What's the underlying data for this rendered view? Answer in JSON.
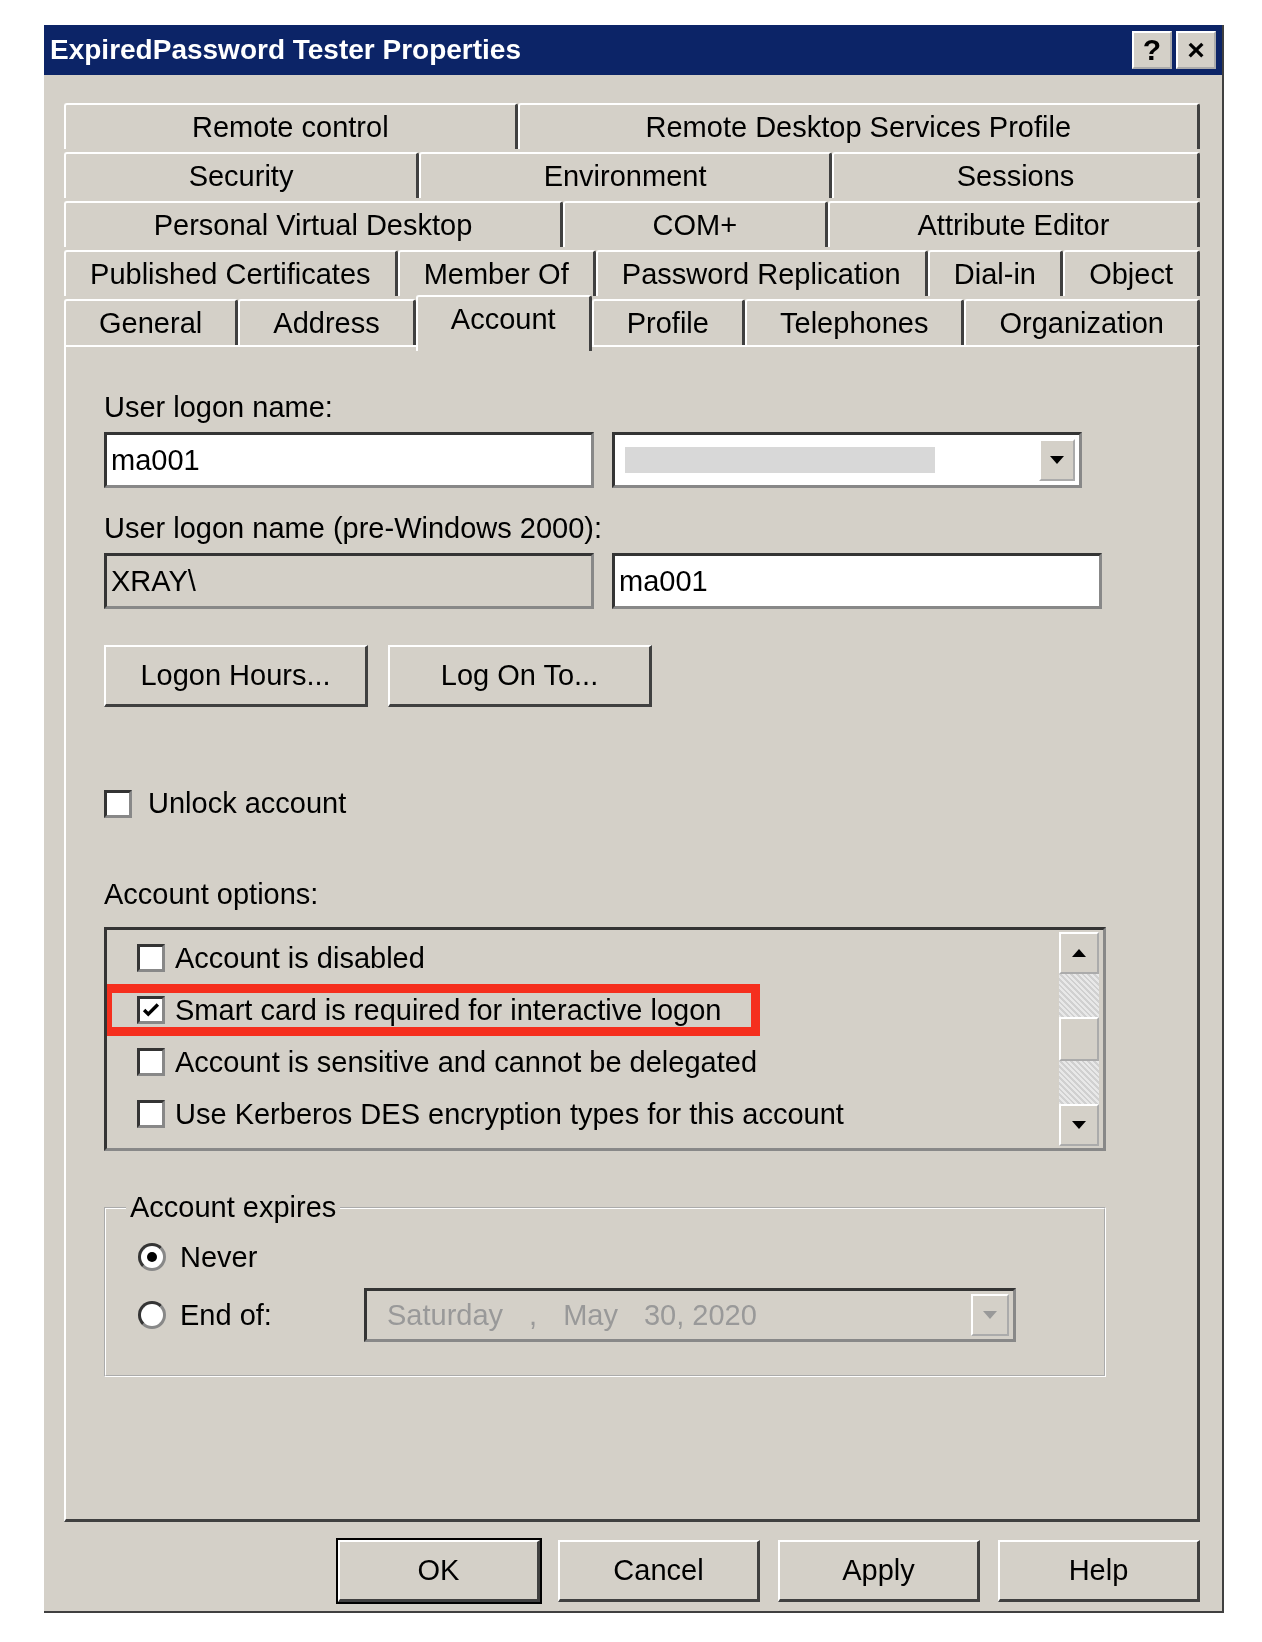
{
  "window": {
    "title": "ExpiredPassword Tester Properties",
    "buttons": [
      "?",
      "×"
    ]
  },
  "tab_rows": [
    [
      {
        "label": "Remote control",
        "selected": false
      },
      {
        "label": "Remote Desktop Services Profile",
        "selected": false
      }
    ],
    [
      {
        "label": "Security",
        "selected": false
      },
      {
        "label": "Environment",
        "selected": false
      },
      {
        "label": "Sessions",
        "selected": false
      }
    ],
    [
      {
        "label": "Personal Virtual Desktop",
        "selected": false
      },
      {
        "label": "COM+",
        "selected": false
      },
      {
        "label": "Attribute Editor",
        "selected": false
      }
    ],
    [
      {
        "label": "Published Certificates",
        "selected": false
      },
      {
        "label": "Member Of",
        "selected": false
      },
      {
        "label": "Password Replication",
        "selected": false
      },
      {
        "label": "Dial-in",
        "selected": false
      },
      {
        "label": "Object",
        "selected": false
      }
    ],
    [
      {
        "label": "General",
        "selected": false
      },
      {
        "label": "Address",
        "selected": false
      },
      {
        "label": "Account",
        "selected": true
      },
      {
        "label": "Profile",
        "selected": false
      },
      {
        "label": "Telephones",
        "selected": false
      },
      {
        "label": "Organization",
        "selected": false
      }
    ]
  ],
  "logon_name": {
    "label": "User logon name:",
    "value": "ma001",
    "suffix_redacted": true
  },
  "pre_windows_2000": {
    "label": "User logon name (pre-Windows 2000):",
    "domain": "XRAY\\",
    "value": "ma001"
  },
  "buttons": [
    "Logon Hours...",
    "Log On To..."
  ],
  "unlock_account": {
    "label": "Unlock account",
    "checked": false
  },
  "account_options": {
    "label": "Account options:",
    "items": [
      {
        "label": "Account is disabled",
        "checked": false,
        "highlighted": false
      },
      {
        "label": "Smart card is required for interactive logon",
        "checked": true,
        "highlighted": true
      },
      {
        "label": "Account is sensitive and cannot be delegated",
        "checked": false,
        "highlighted": false
      },
      {
        "label": "Use Kerberos DES encryption types for this account",
        "checked": false,
        "highlighted": false
      }
    ]
  },
  "account_expires": {
    "label": "Account expires",
    "options": [
      {
        "label": "Never",
        "selected": true
      },
      {
        "label": "End of:",
        "selected": false
      }
    ],
    "date": {
      "parts": [
        "Saturday",
        ",",
        "May",
        "30, 2020"
      ],
      "disabled": true
    }
  },
  "footer_buttons": [
    "OK",
    "Cancel",
    "Apply",
    "Help"
  ]
}
